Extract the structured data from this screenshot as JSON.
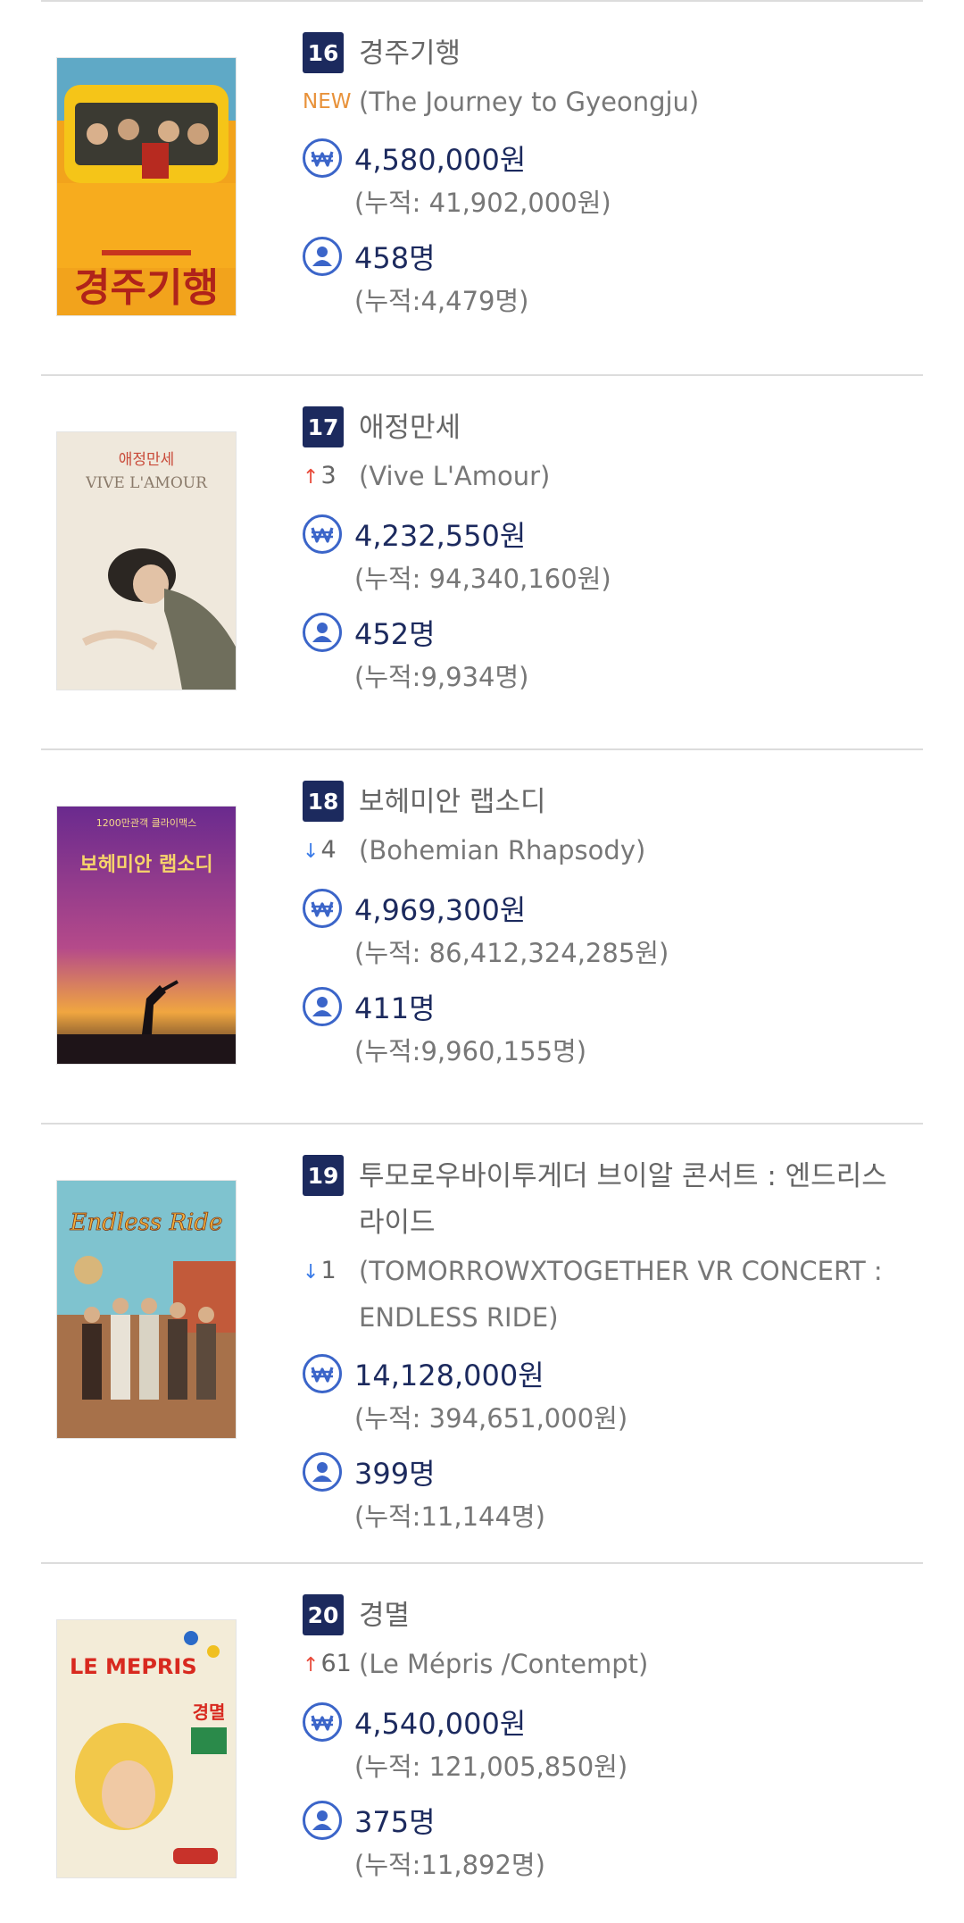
{
  "movies": [
    {
      "rank": "16",
      "title_ko": "경주기행",
      "change_type": "new",
      "change_label": "NEW",
      "title_en": "(The Journey to Gyeongju)",
      "sales": "4,580,000원",
      "sales_cum": "(누적: 41,902,000원)",
      "audience": "458명",
      "audience_cum": "(누적:4,479명)",
      "poster_text": "경주기행",
      "poster_top_text": ""
    },
    {
      "rank": "17",
      "title_ko": "애정만세",
      "change_type": "up",
      "change_label": "3",
      "title_en": "(Vive L'Amour)",
      "sales": "4,232,550원",
      "sales_cum": "(누적: 94,340,160원)",
      "audience": "452명",
      "audience_cum": "(누적:9,934명)",
      "poster_text": "VIVE L'AMOUR",
      "poster_top_text": "애정만세"
    },
    {
      "rank": "18",
      "title_ko": "보헤미안 랩소디",
      "change_type": "down",
      "change_label": "4",
      "title_en": "(Bohemian Rhapsody)",
      "sales": "4,969,300원",
      "sales_cum": "(누적: 86,412,324,285원)",
      "audience": "411명",
      "audience_cum": "(누적:9,960,155명)",
      "poster_text": "보헤미안 랩소디",
      "poster_top_text": "1200만관객 클라이맥스"
    },
    {
      "rank": "19",
      "title_ko": "투모로우바이투게더 브이알 콘서트 : 엔드리스 라이드",
      "change_type": "down",
      "change_label": "1",
      "title_en": "(TOMORROWXTOGETHER VR CONCERT : ENDLESS RIDE)",
      "sales": "14,128,000원",
      "sales_cum": "(누적: 394,651,000원)",
      "audience": "399명",
      "audience_cum": "(누적:11,144명)",
      "poster_text": "Endless Ride",
      "poster_top_text": ""
    },
    {
      "rank": "20",
      "title_ko": "경멸",
      "change_type": "up",
      "change_label": "61",
      "title_en": "(Le Mépris /Contempt)",
      "sales": "4,540,000원",
      "sales_cum": "(누적: 121,005,850원)",
      "audience": "375명",
      "audience_cum": "(누적:11,892명)",
      "poster_text": "LE MEPRIS",
      "poster_top_text": "경멸"
    }
  ],
  "icons": {
    "sales": "won-icon",
    "audience": "person-icon"
  },
  "colors": {
    "rank_badge": "#1c2a5e",
    "value_text": "#1c2a5e",
    "icon": "#3b65c9",
    "new": "#e8923a",
    "up": "#e84a3a",
    "down": "#3a7be8"
  }
}
